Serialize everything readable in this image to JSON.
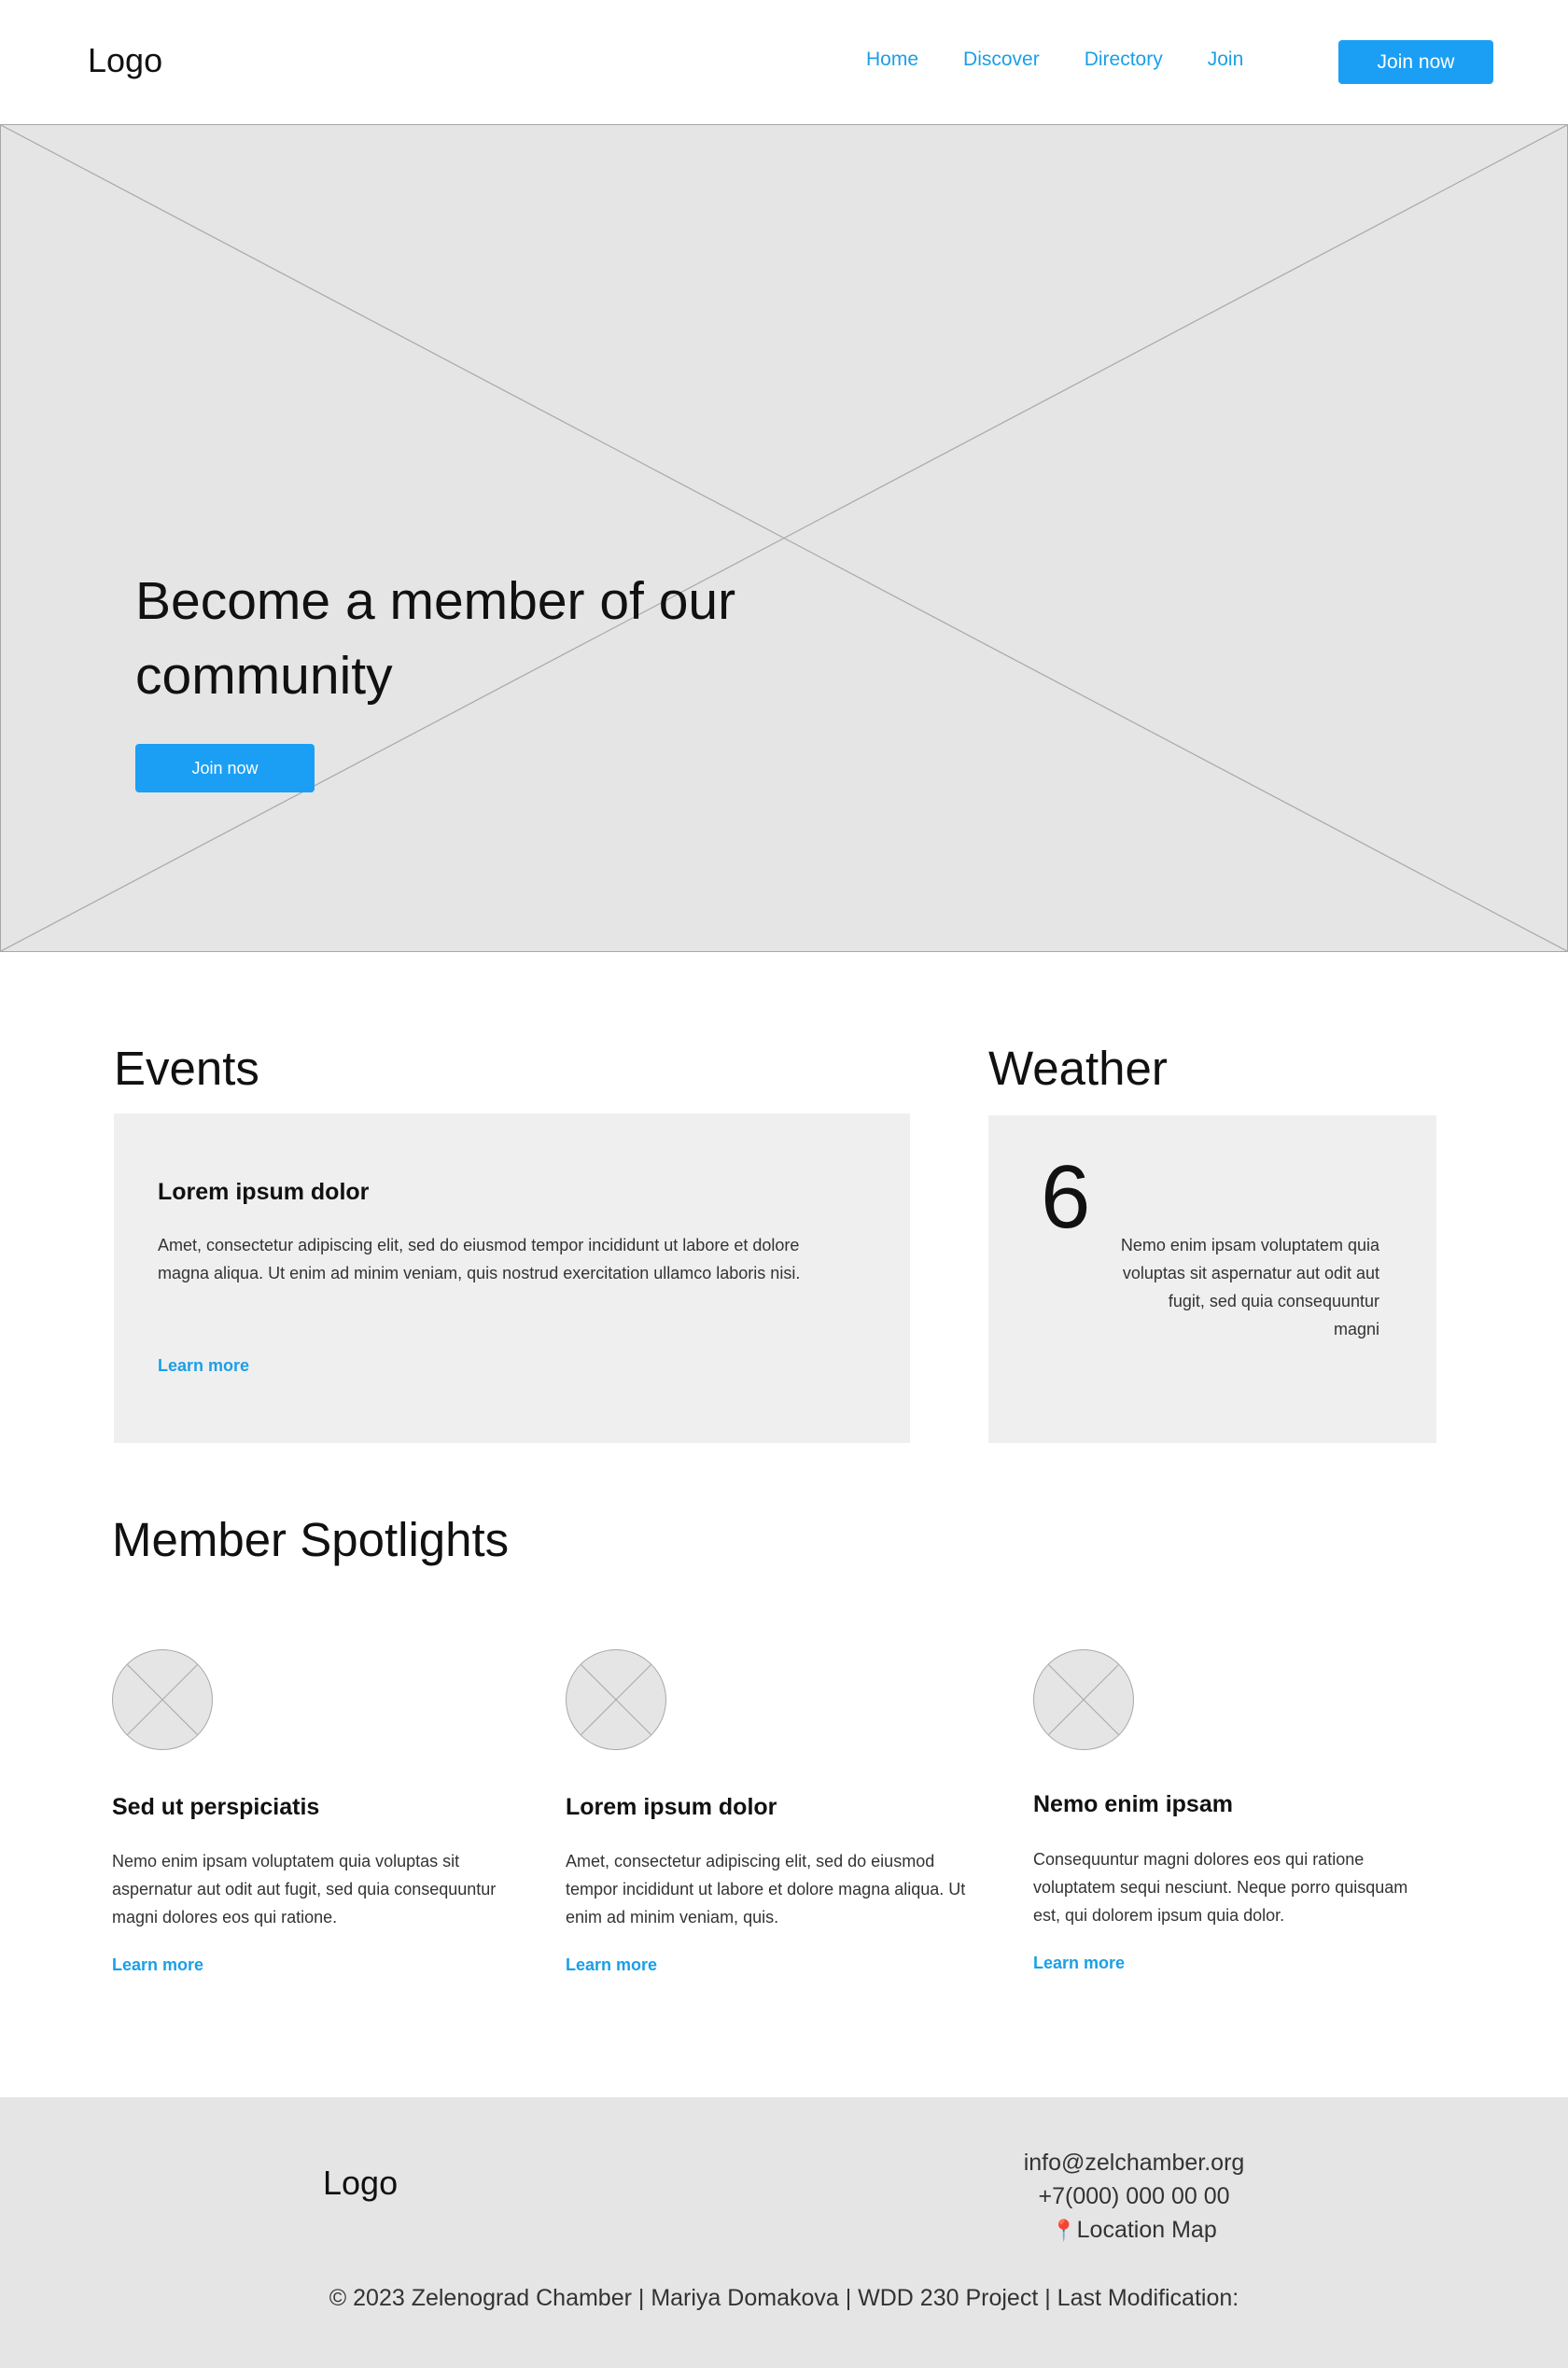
{
  "header": {
    "logo": "Logo",
    "nav": [
      "Home",
      "Discover",
      "Directory",
      "Join"
    ],
    "cta_label": "Join now"
  },
  "hero": {
    "title": "Become a member of our community",
    "cta_label": "Join now",
    "image_placeholder": "image-placeholder"
  },
  "events": {
    "title": "Events",
    "card": {
      "heading": "Lorem ipsum dolor",
      "text": "Amet, consectetur adipiscing elit, sed do eiusmod tempor incididunt ut labore et dolore magna aliqua. Ut enim ad minim veniam, quis nostrud exercitation ullamco laboris nisi.",
      "link": "Learn more"
    }
  },
  "weather": {
    "title": "Weather",
    "temperature": "6",
    "description": "Nemo enim ipsam voluptatem quia voluptas sit aspernatur aut odit aut fugit, sed quia consequuntur magni"
  },
  "spotlights": {
    "title": "Member Spotlights",
    "items": [
      {
        "heading": "Sed ut perspiciatis",
        "text": "Nemo enim ipsam voluptatem quia voluptas sit aspernatur aut odit aut fugit, sed quia consequuntur magni dolores eos qui ratione.",
        "link": "Learn more"
      },
      {
        "heading": "Lorem ipsum dolor",
        "text": "Amet, consectetur adipiscing elit, sed do eiusmod tempor incididunt ut labore et dolore magna aliqua. Ut enim ad minim veniam, quis.",
        "link": "Learn more"
      },
      {
        "heading": "Nemo enim ipsam",
        "text": "Consequuntur magni dolores eos qui ratione voluptatem sequi nesciunt. Neque porro quisquam est, qui dolorem ipsum quia dolor.",
        "link": "Learn more"
      }
    ]
  },
  "footer": {
    "logo": "Logo",
    "email": "info@zelchamber.org",
    "phone": "+7(000) 000 00 00",
    "location_icon": "📍",
    "location": "Location Map",
    "copyright": "© 2023 Zelenograd Chamber | Mariya Domakova | WDD 230 Project | Last Modification:"
  },
  "colors": {
    "accent": "#1a9ff5",
    "placeholder": "#e5e5e5",
    "card": "#efefef"
  }
}
